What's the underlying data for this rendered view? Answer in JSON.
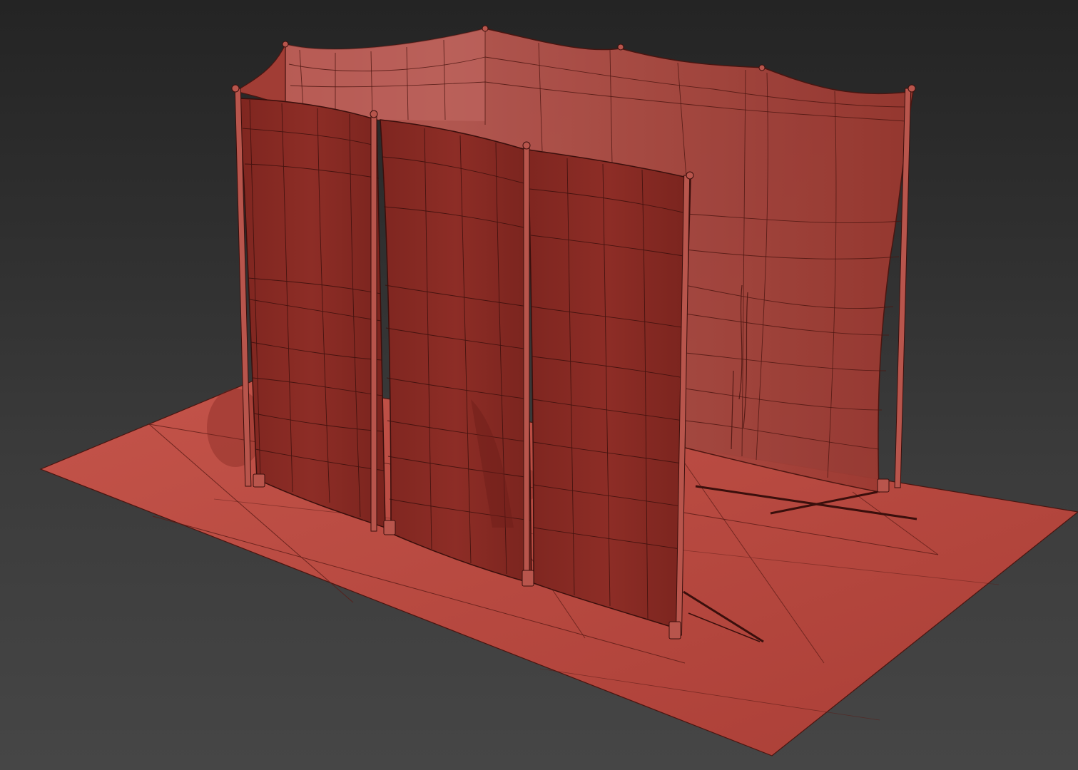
{
  "scene": {
    "colors": {
      "background_top": "#242424",
      "background_bottom": "#464646",
      "ground_fill": "#b9483f",
      "panel_fill": "#8c2c25",
      "back_panel_fill": "#a8423a",
      "wire": "#3a0f0c",
      "pole": "#b8554c"
    },
    "objects": [
      "ground-plane",
      "back-curtain",
      "front-panel-left",
      "front-panel-middle",
      "front-panel-right",
      "support-poles",
      "brace-rods"
    ]
  }
}
